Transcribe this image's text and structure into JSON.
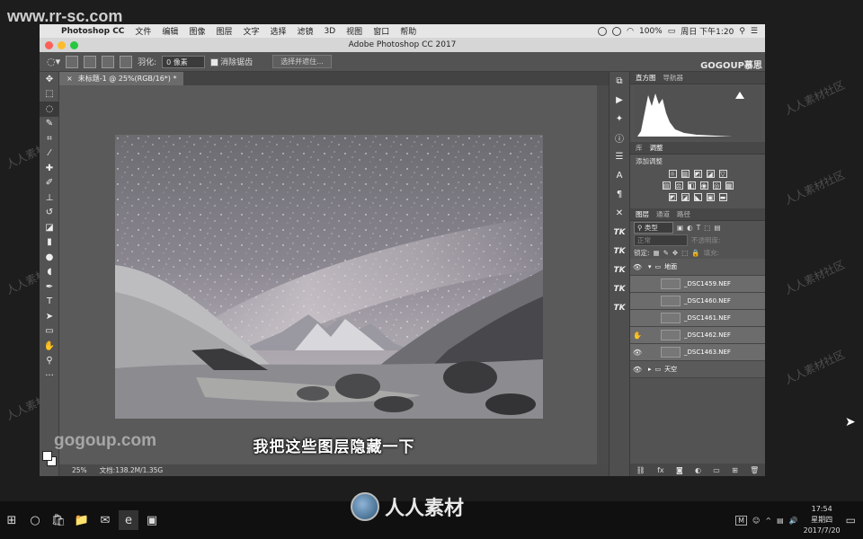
{
  "watermark_top": "www.rr-sc.com",
  "diag_watermark": "人人素材社区",
  "menubar": {
    "items": [
      "Photoshop CC",
      "文件",
      "编辑",
      "图像",
      "图层",
      "文字",
      "选择",
      "滤镜",
      "3D",
      "视图",
      "窗口",
      "帮助"
    ],
    "battery": "100%",
    "clock": "周日 下午1:20"
  },
  "window": {
    "title": "Adobe Photoshop CC 2017"
  },
  "optbar": {
    "feather_label": "羽化:",
    "feather_value": "0 像素",
    "antialias_label": "消除锯齿",
    "select_mask_button": "选择并遮住..."
  },
  "brand_logo": "GOGOUP慕思手",
  "document": {
    "tab_close": "×",
    "tab_title": "未标题-1 @ 25%(RGB/16*) *",
    "zoom": "25%",
    "docinfo": "文档:138.2M/1.35G"
  },
  "subtitle": "我把这些图层隐藏一下",
  "gogoup_watermark": "gogoup.com",
  "panels": {
    "top_tabs": [
      "直方图",
      "导航器"
    ],
    "adj_tabs": [
      "库",
      "调整"
    ],
    "adj_title": "添加调整",
    "layer_tabs": [
      "图层",
      "通道",
      "路径"
    ],
    "kind_filter": "类型",
    "blend_mode": "正常",
    "opacity_label": "不透明度:",
    "lock_label": "锁定:",
    "fill_label": "填充:",
    "layers": [
      {
        "name": "地面",
        "type": "group",
        "visible": true
      },
      {
        "name": "_DSC1459.NEF",
        "type": "layer",
        "visible": true
      },
      {
        "name": "_DSC1460.NEF",
        "type": "layer",
        "visible": false
      },
      {
        "name": "_DSC1461.NEF",
        "type": "layer",
        "visible": false
      },
      {
        "name": "_DSC1462.NEF",
        "type": "layer",
        "visible": true
      },
      {
        "name": "_DSC1463.NEF",
        "type": "layer",
        "visible": true
      },
      {
        "name": "天空",
        "type": "group",
        "visible": true
      }
    ]
  },
  "taskbar": {
    "time": "17:54",
    "weekday": "星期四",
    "date": "2017/7/20",
    "ime": "M"
  },
  "rr_logo_text": "人人素材",
  "colors": {
    "menubar_bg": "#e6e6e6",
    "ps_panel": "#535353",
    "canvas_bg": "#5a5a5a",
    "taskbar": "#101010"
  }
}
